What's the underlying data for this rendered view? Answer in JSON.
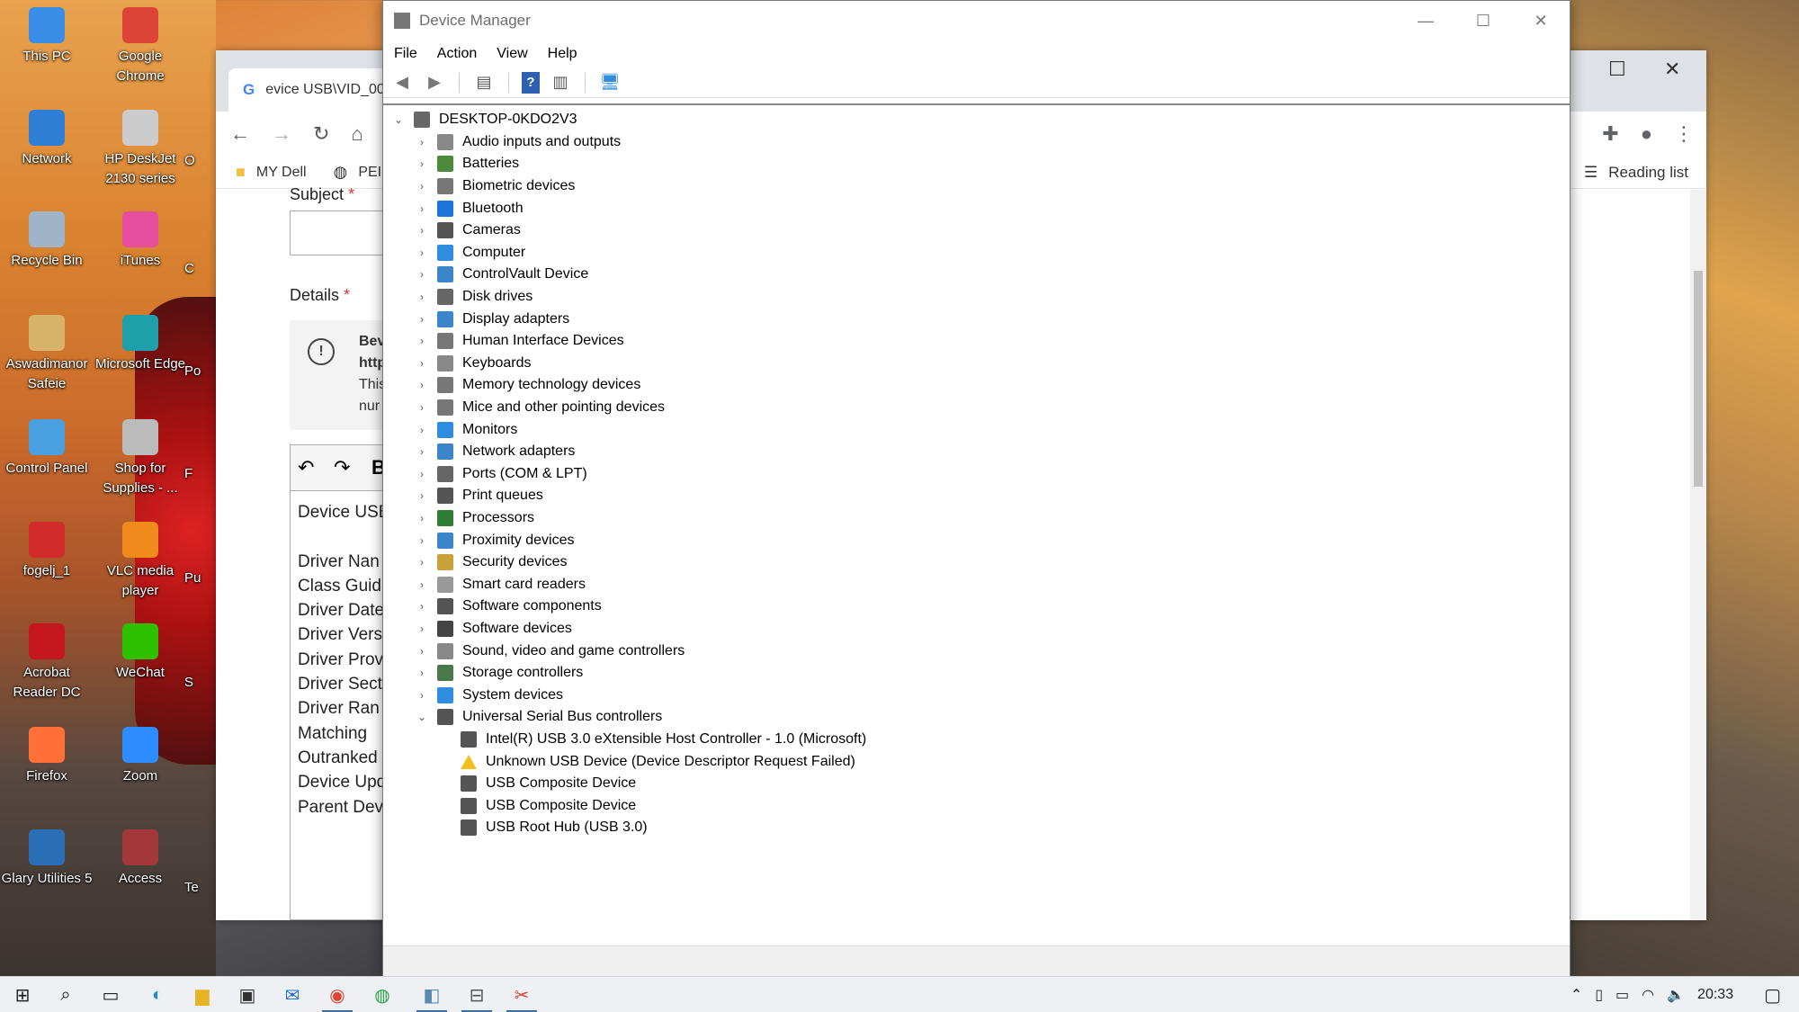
{
  "desktop": {
    "icons": [
      {
        "label": "This PC",
        "icon": "computer-icon",
        "color": "#3a8ee6"
      },
      {
        "label": "Google Chrome",
        "icon": "chrome-icon",
        "color": "#db4437"
      },
      {
        "label": "Network",
        "icon": "network-icon",
        "color": "#2f7fd6"
      },
      {
        "label": "HP DeskJet 2130 series",
        "icon": "printer-icon",
        "color": "#cccccc"
      },
      {
        "label": "Recycle Bin",
        "icon": "recycle-bin-icon",
        "color": "#9fb4c8"
      },
      {
        "label": "iTunes",
        "icon": "itunes-icon",
        "color": "#e64fa0"
      },
      {
        "label": "Aswadimanor Safeie",
        "icon": "user-folder-icon",
        "color": "#d7b36a"
      },
      {
        "label": "Microsoft Edge",
        "icon": "edge-icon",
        "color": "#1fa0a8"
      },
      {
        "label": "Control Panel",
        "icon": "control-panel-icon",
        "color": "#4aa0e0"
      },
      {
        "label": "Shop for Supplies - ...",
        "icon": "shop-printer-icon",
        "color": "#bbbbbb"
      },
      {
        "label": "fogelj_1",
        "icon": "pdf-icon",
        "color": "#d22b2b"
      },
      {
        "label": "VLC media player",
        "icon": "vlc-icon",
        "color": "#f08a1c"
      },
      {
        "label": "Acrobat Reader DC",
        "icon": "acrobat-icon",
        "color": "#c4161c"
      },
      {
        "label": "WeChat",
        "icon": "wechat-icon",
        "color": "#2dc100"
      },
      {
        "label": "Firefox",
        "icon": "firefox-icon",
        "color": "#ff7139"
      },
      {
        "label": "Zoom",
        "icon": "zoom-icon",
        "color": "#2d8cff"
      },
      {
        "label": "Glary Utilities 5",
        "icon": "glary-icon",
        "color": "#2a6fb5"
      },
      {
        "label": "Access",
        "icon": "access-icon",
        "color": "#a4373a"
      }
    ],
    "partial_labels": [
      "O",
      "C",
      "Po",
      "F",
      "Pu",
      "S",
      "Te"
    ]
  },
  "browser": {
    "tab_title": "evice USB\\VID_00",
    "bookmarks": [
      "MY Dell",
      "PEI"
    ],
    "reading_list": "Reading list",
    "form": {
      "subject_label": "Subject",
      "required_mark": "*",
      "details_label": "Details",
      "notice_lines": [
        "Bev",
        "http",
        "This",
        "nur"
      ],
      "editor_lines": [
        "Device USB",
        "",
        "Driver Nan",
        "Class Guid",
        "Driver Date",
        "Driver Vers",
        "Driver Prov",
        "Driver Sect",
        "Driver Ran",
        "Matching",
        "Outranked",
        "Device Upd",
        "Parent Dev"
      ]
    }
  },
  "device_manager": {
    "title": "Device Manager",
    "menu": [
      "File",
      "Action",
      "View",
      "Help"
    ],
    "root": "DESKTOP-0KDO2V3",
    "categories": [
      {
        "label": "Audio inputs and outputs",
        "icon": "speaker-icon",
        "color": "#888888"
      },
      {
        "label": "Batteries",
        "icon": "battery-icon",
        "color": "#4a8a3a"
      },
      {
        "label": "Biometric devices",
        "icon": "biometric-icon",
        "color": "#777777"
      },
      {
        "label": "Bluetooth",
        "icon": "bluetooth-icon",
        "color": "#1e73d8"
      },
      {
        "label": "Cameras",
        "icon": "camera-icon",
        "color": "#555555"
      },
      {
        "label": "Computer",
        "icon": "computer-icon",
        "color": "#2f8ddf"
      },
      {
        "label": "ControlVault Device",
        "icon": "controlvault-icon",
        "color": "#3a86c8"
      },
      {
        "label": "Disk drives",
        "icon": "disk-icon",
        "color": "#666666"
      },
      {
        "label": "Display adapters",
        "icon": "display-adapter-icon",
        "color": "#3a86c8"
      },
      {
        "label": "Human Interface Devices",
        "icon": "hid-icon",
        "color": "#777777"
      },
      {
        "label": "Keyboards",
        "icon": "keyboard-icon",
        "color": "#888888"
      },
      {
        "label": "Memory technology devices",
        "icon": "memory-icon",
        "color": "#777777"
      },
      {
        "label": "Mice and other pointing devices",
        "icon": "mouse-icon",
        "color": "#777777"
      },
      {
        "label": "Monitors",
        "icon": "monitor-icon",
        "color": "#2f8ddf"
      },
      {
        "label": "Network adapters",
        "icon": "network-adapter-icon",
        "color": "#3a86c8"
      },
      {
        "label": "Ports (COM & LPT)",
        "icon": "port-icon",
        "color": "#666666"
      },
      {
        "label": "Print queues",
        "icon": "print-queue-icon",
        "color": "#555555"
      },
      {
        "label": "Processors",
        "icon": "processor-icon",
        "color": "#2e7d32"
      },
      {
        "label": "Proximity devices",
        "icon": "proximity-icon",
        "color": "#3a86c8"
      },
      {
        "label": "Security devices",
        "icon": "security-icon",
        "color": "#caa23a"
      },
      {
        "label": "Smart card readers",
        "icon": "smart-card-icon",
        "color": "#999999"
      },
      {
        "label": "Software components",
        "icon": "software-component-icon",
        "color": "#555555"
      },
      {
        "label": "Software devices",
        "icon": "software-device-icon",
        "color": "#444444"
      },
      {
        "label": "Sound, video and game controllers",
        "icon": "sound-icon",
        "color": "#888888"
      },
      {
        "label": "Storage controllers",
        "icon": "storage-icon",
        "color": "#4a7a4a"
      },
      {
        "label": "System devices",
        "icon": "system-device-icon",
        "color": "#2f8ddf"
      },
      {
        "label": "Universal Serial Bus controllers",
        "icon": "usb-icon",
        "color": "#555555",
        "expanded": true
      }
    ],
    "usb_children": [
      {
        "label": "Intel(R) USB 3.0 eXtensible Host Controller - 1.0 (Microsoft)",
        "icon": "usb-icon",
        "warning": false
      },
      {
        "label": "Unknown USB Device (Device Descriptor Request Failed)",
        "icon": "warning-icon",
        "warning": true
      },
      {
        "label": "USB Composite Device",
        "icon": "usb-icon",
        "warning": false
      },
      {
        "label": "USB Composite Device",
        "icon": "usb-icon",
        "warning": false
      },
      {
        "label": "USB Root Hub (USB 3.0)",
        "icon": "usb-icon",
        "warning": false
      }
    ]
  },
  "taskbar": {
    "clock": "20:33"
  }
}
